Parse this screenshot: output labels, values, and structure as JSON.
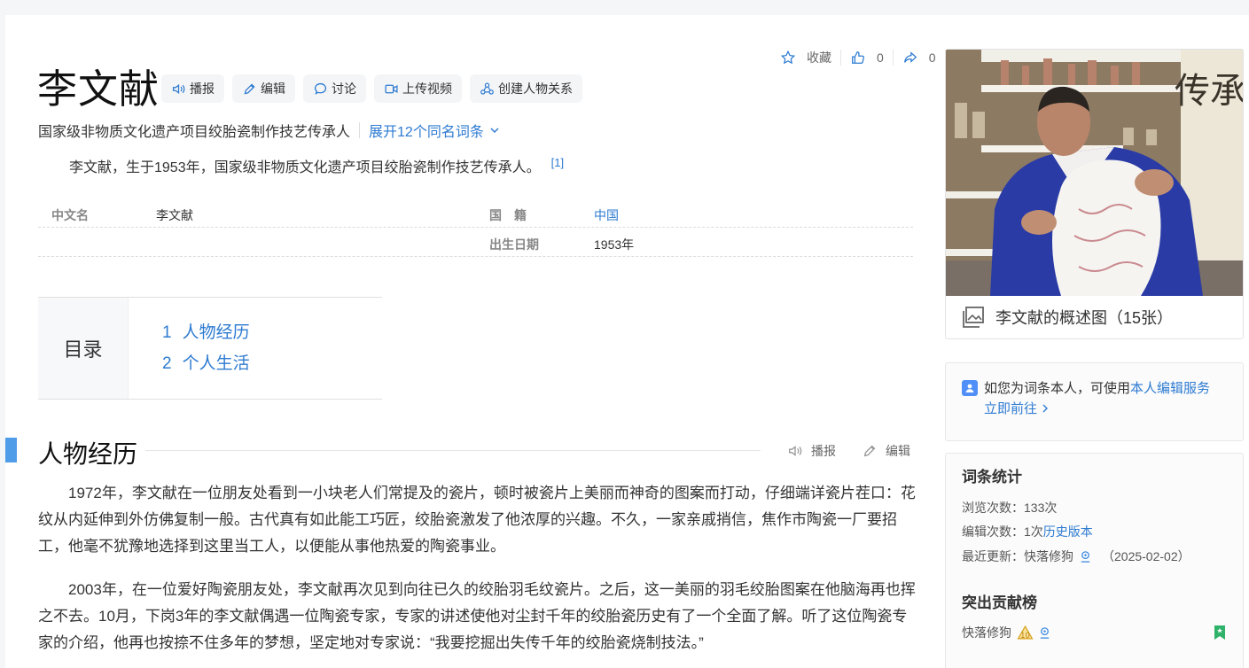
{
  "entry": {
    "title": "李文献",
    "subtitle": "国家级非物质文化遗产项目绞胎瓷制作技艺传承人",
    "expand": "展开12个同名词条",
    "summary": "李文献，生于1953年，国家级非物质文化遗产项目绞胎瓷制作技艺传承人。",
    "summary_ref": "[1]"
  },
  "title_buttons": {
    "broadcast": "播报",
    "edit": "编辑",
    "discuss": "讨论",
    "upload_video": "上传视频",
    "create_relation": "创建人物关系"
  },
  "top_actions": {
    "favorite": "收藏",
    "likes": "0",
    "shares": "0"
  },
  "basic_info": {
    "name_label": "中文名",
    "name_value": "李文献",
    "nationality_label": "国　籍",
    "nationality_value": "中国",
    "birth_label": "出生日期",
    "birth_value": "1953年"
  },
  "catalog": {
    "head": "目录",
    "items": [
      {
        "num": "1",
        "label": "人物经历"
      },
      {
        "num": "2",
        "label": "个人生活"
      }
    ]
  },
  "section": {
    "title": "人物经历",
    "broadcast": "播报",
    "edit": "编辑",
    "paragraphs": [
      "1972年，李文献在一位朋友处看到一小块老人们常提及的瓷片，顿时被瓷片上美丽而神奇的图案而打动，仔细端详瓷片茬口：花纹从内延伸到外仿佛复制一般。古代真有如此能工巧匠，绞胎瓷激发了他浓厚的兴趣。不久，一家亲戚捎信，焦作市陶瓷一厂要招工，他毫不犹豫地选择到这里当工人，以便能从事他热爱的陶瓷事业。",
      "2003年，在一位爱好陶瓷朋友处，李文献再次见到向往已久的绞胎羽毛纹瓷片。之后，这一美丽的羽毛绞胎图案在他脑海再也挥之不去。10月，下岗3年的李文献偶遇一位陶瓷专家，专家的讲述使他对尘封千年的绞胎瓷历史有了一个全面了解。听了这位陶瓷专家的介绍，他再也按捺不住多年的梦想，坚定地对专家说：“我要挖掘出失传千年的绞胎瓷烧制技法。”"
    ]
  },
  "sidebar": {
    "album_caption": "李文献的概述图（15张）",
    "photo_text": "传承",
    "self_prompt": "如您为词条本人，可使用",
    "self_link": "本人编辑服务",
    "self_go": "立即前往",
    "stats_title": "词条统计",
    "views_label": "浏览次数：",
    "views_value": "133次",
    "edits_label": "编辑次数：",
    "edits_value": "1次",
    "history_link": "历史版本",
    "updated_label": "最近更新：",
    "updated_user": "快落修狗",
    "updated_date": "（2025-02-02）",
    "contrib_title": "突出贡献榜",
    "contrib_user": "快落修狗"
  }
}
